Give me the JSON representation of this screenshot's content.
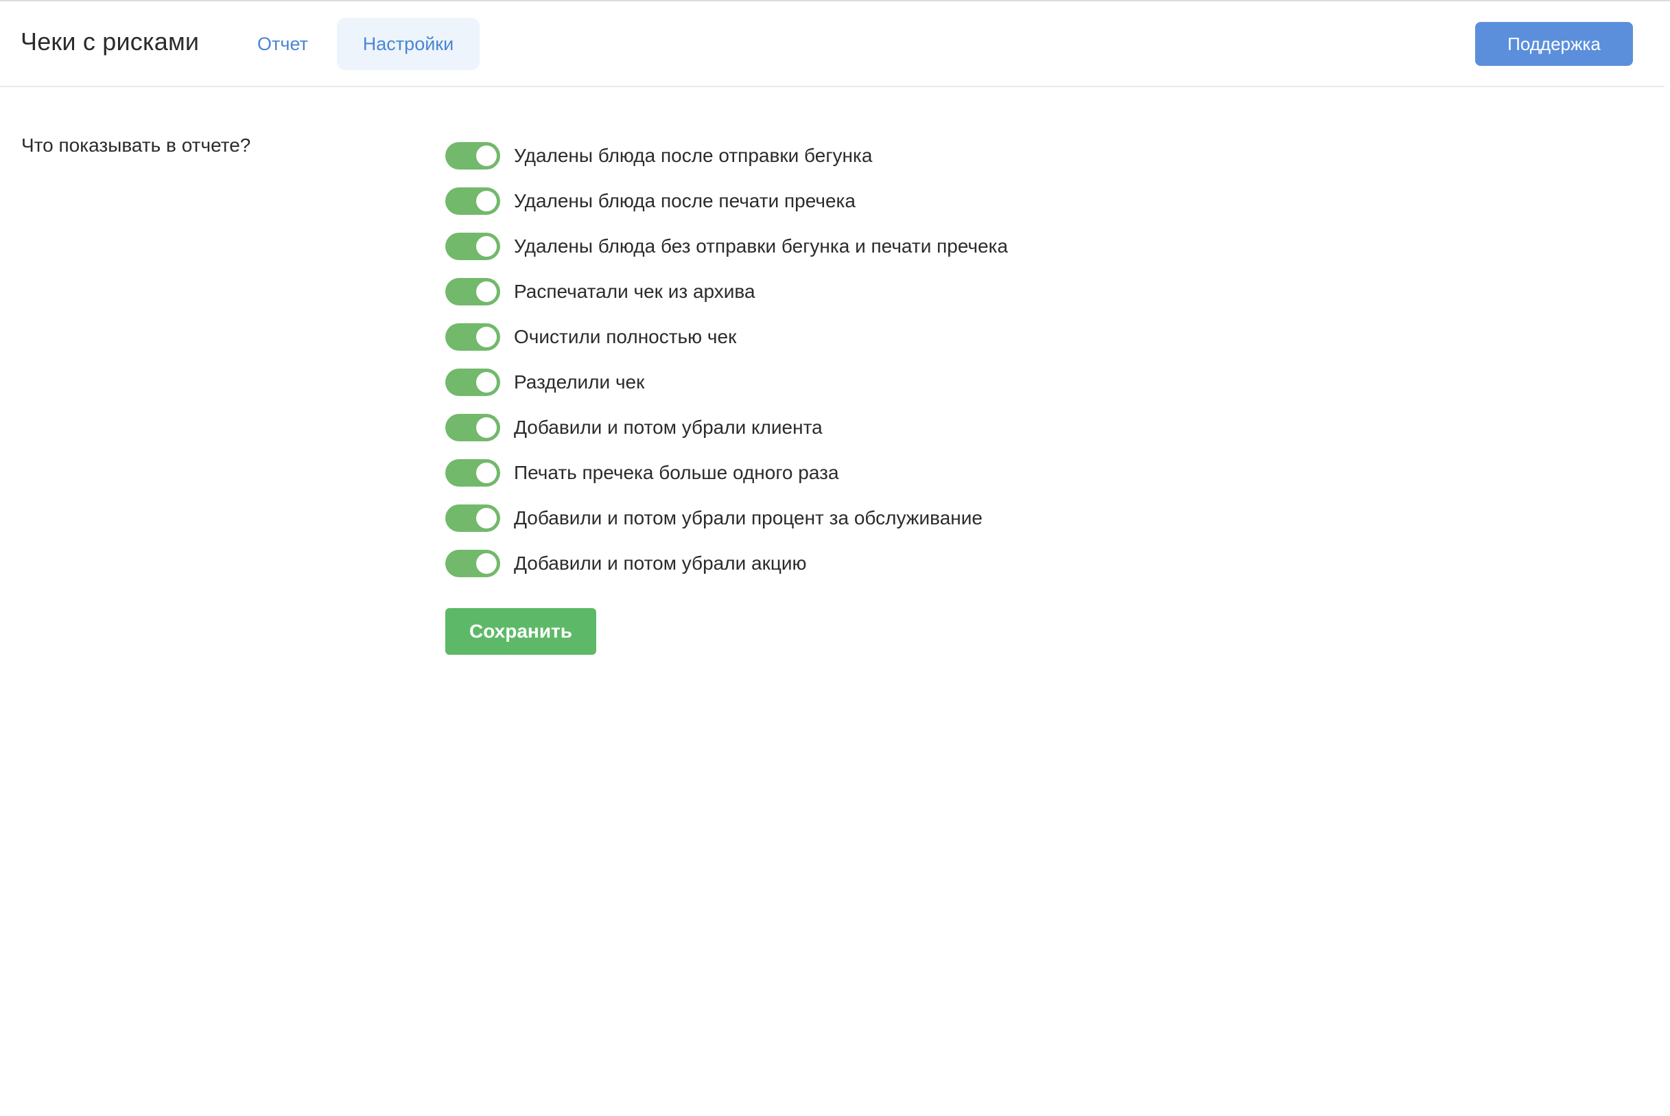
{
  "header": {
    "title": "Чеки с рисками",
    "tabs": [
      {
        "label": "Отчет",
        "active": false
      },
      {
        "label": "Настройки",
        "active": true
      }
    ],
    "support_label": "Поддержка"
  },
  "settings": {
    "section_label": "Что показывать в отчете?",
    "options": [
      {
        "label": "Удалены блюда после отправки бегунка",
        "enabled": true
      },
      {
        "label": "Удалены блюда после печати пречека",
        "enabled": true
      },
      {
        "label": "Удалены блюда без отправки бегунка и печати пречека",
        "enabled": true
      },
      {
        "label": "Распечатали чек из архива",
        "enabled": true
      },
      {
        "label": "Очистили полностью чек",
        "enabled": true
      },
      {
        "label": "Разделили чек",
        "enabled": true
      },
      {
        "label": "Добавили и потом убрали клиента",
        "enabled": true
      },
      {
        "label": "Печать пречека больше одного раза",
        "enabled": true
      },
      {
        "label": "Добавили и потом убрали процент за обслуживание",
        "enabled": true
      },
      {
        "label": "Добавили и потом убрали акцию",
        "enabled": true
      }
    ],
    "save_label": "Сохранить"
  },
  "colors": {
    "accent_blue": "#5b8fdb",
    "tab_text": "#4a86d2",
    "tab_active_bg": "#edf4fc",
    "toggle_on": "#72b96b",
    "save_green": "#5db967"
  }
}
